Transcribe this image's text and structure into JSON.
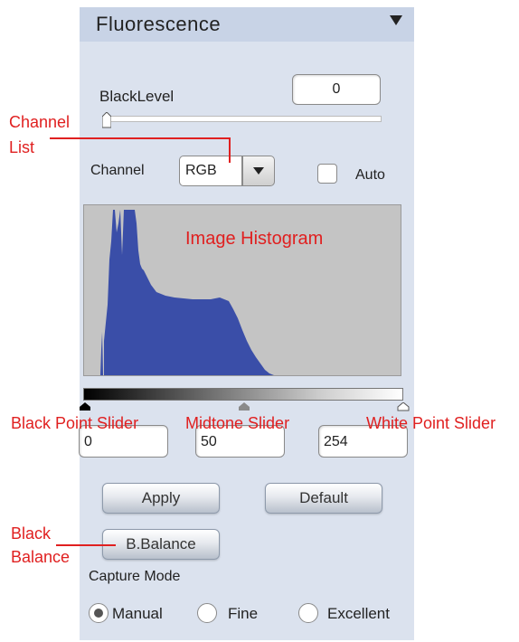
{
  "panel": {
    "title": "Fluorescence",
    "black_level": {
      "label": "BlackLevel",
      "value": "0"
    },
    "channel": {
      "label": "Channel",
      "selected": "RGB"
    },
    "auto": {
      "label": "Auto",
      "checked": false
    },
    "levels": {
      "black": "0",
      "midtone": "50",
      "white": "254"
    },
    "buttons": {
      "apply": "Apply",
      "default": "Default",
      "balance": "B.Balance"
    },
    "capture_mode": {
      "label": "Capture Mode",
      "options": [
        "Manual",
        "Fine",
        "Excellent"
      ],
      "selected": "Manual"
    }
  },
  "annotations": {
    "channel_list": [
      "Channel",
      "List"
    ],
    "image_histogram": "Image Histogram",
    "black_point_slider": "Black Point Slider",
    "midtone_slider": "Midtone Slider",
    "white_point_slider": "White Point Slider",
    "black_balance": [
      "Black",
      "Balance"
    ]
  },
  "colors": {
    "histogram_fill": "#3a4ea8",
    "annotation": "#e02020"
  }
}
